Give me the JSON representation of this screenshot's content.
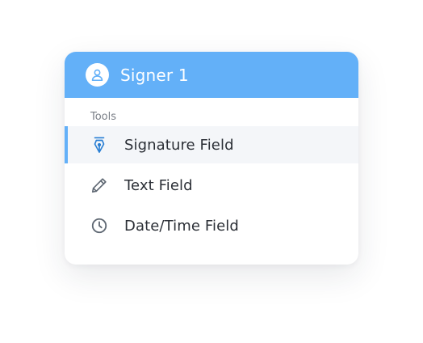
{
  "signer": {
    "name": "Signer 1",
    "icon": "user-icon"
  },
  "tools": {
    "section_label": "Tools",
    "items": [
      {
        "label": "Signature Field",
        "icon": "pen-nib-icon",
        "selected": true
      },
      {
        "label": "Text Field",
        "icon": "pencil-icon",
        "selected": false
      },
      {
        "label": "Date/Time Field",
        "icon": "clock-icon",
        "selected": false
      }
    ]
  },
  "colors": {
    "accent": "#63b0f8",
    "selected_icon": "#2a7fd4",
    "icon": "#5f6873",
    "text": "#2b2f36",
    "muted": "#7a7f87"
  }
}
